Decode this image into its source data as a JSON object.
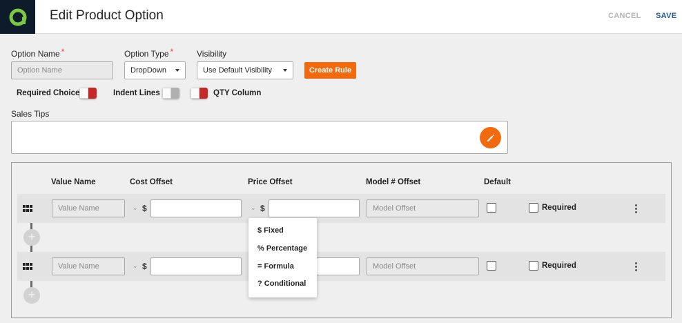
{
  "header": {
    "title": "Edit Product Option",
    "cancel_label": "CANCEL",
    "save_label": "SAVE",
    "logo_icon": "app-logo-icon"
  },
  "form": {
    "option_name": {
      "label": "Option Name",
      "required_mark": "*",
      "placeholder": "Option Name",
      "value": ""
    },
    "option_type": {
      "label": "Option Type",
      "required_mark": "*",
      "value": "DropDown"
    },
    "visibility": {
      "label": "Visibility",
      "value": "Use Default Visibility"
    },
    "create_rule_label": "Create Rule",
    "toggles": {
      "required_choice": {
        "label": "Required Choice",
        "on": true
      },
      "indent_lines": {
        "label": "Indent Lines",
        "on": false
      },
      "qty_column": {
        "label": "QTY Column",
        "on": true
      }
    },
    "sales_tips": {
      "label": "Sales Tips",
      "value": ""
    }
  },
  "values_table": {
    "headers": {
      "value_name": "Value Name",
      "cost_offset": "Cost Offset",
      "price_offset": "Price Offset",
      "model_offset": "Model # Offset",
      "default": "Default"
    },
    "rows": [
      {
        "value_name_placeholder": "Value Name",
        "currency": "$",
        "price_currency": "$",
        "model_placeholder": "Model Offset",
        "required_label": "Required",
        "default_checked": false,
        "required_checked": false
      },
      {
        "value_name_placeholder": "Value Name",
        "currency": "$",
        "model_placeholder": "Model Offset",
        "required_label": "Required",
        "default_checked": false,
        "required_checked": false
      }
    ]
  },
  "price_type_menu": {
    "items": [
      "$ Fixed",
      "% Percentage",
      "= Formula",
      "? Conditional"
    ]
  },
  "colors": {
    "accent": "#f26a0d",
    "toggle_on": "#c62828",
    "toggle_off": "#b0b0b0",
    "link_blue": "#1f5a96",
    "logo_bg": "#0d1b2a",
    "logo_green": "#7ac943"
  }
}
